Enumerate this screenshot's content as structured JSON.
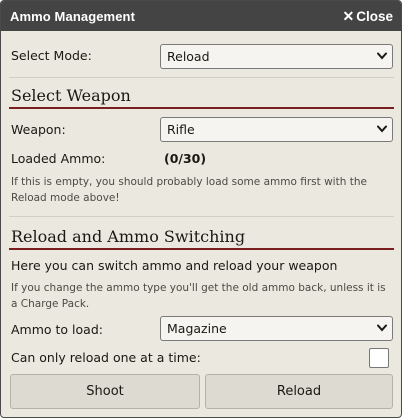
{
  "window": {
    "title": "Ammo Management",
    "close_label": "Close",
    "close_icon": "close-icon"
  },
  "mode": {
    "label": "Select Mode:",
    "value": "Reload"
  },
  "weapon_section": {
    "heading": "Select Weapon",
    "weapon_label": "Weapon:",
    "weapon_value": "Rifle",
    "loaded_label": "Loaded Ammo:",
    "loaded_value": "(0/30)",
    "hint": "If this is empty, you should probably load some ammo first with the Reload mode above!"
  },
  "reload_section": {
    "heading": "Reload and Ammo Switching",
    "intro": "Here you can switch ammo and reload your weapon",
    "note": "If you change the ammo type you'll get the old ammo back, unless it is a Charge Pack.",
    "ammo_label": "Ammo to load:",
    "ammo_value": "Magazine",
    "one_at_a_time_label": "Can only reload one at a time:",
    "one_at_a_time_checked": false
  },
  "buttons": {
    "shoot": "Shoot",
    "reload": "Reload"
  }
}
